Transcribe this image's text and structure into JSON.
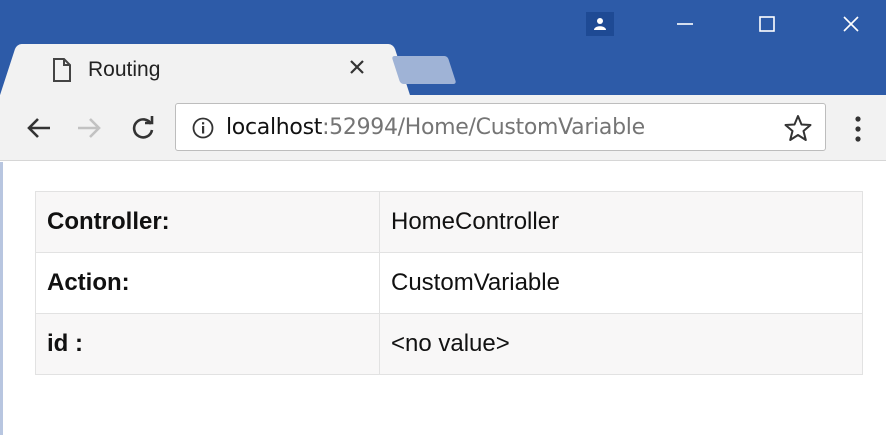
{
  "tab": {
    "title": "Routing"
  },
  "address_bar": {
    "host": "localhost",
    "rest": ":52994/Home/CustomVariable"
  },
  "table": {
    "rows": [
      {
        "label": "Controller:",
        "value": "HomeController"
      },
      {
        "label": "Action:",
        "value": "CustomVariable"
      },
      {
        "label": "id :",
        "value": "<no value>"
      }
    ]
  },
  "colors": {
    "titlebar": "#2d5ba8",
    "toolbar": "#f2f2f2",
    "row_stripe": "#f8f7f7"
  },
  "icons": [
    "page-icon",
    "close-icon",
    "user-icon",
    "minimize-icon",
    "maximize-icon",
    "window-close-icon",
    "back-icon",
    "forward-icon",
    "reload-icon",
    "info-icon",
    "star-icon",
    "menu-icon"
  ]
}
